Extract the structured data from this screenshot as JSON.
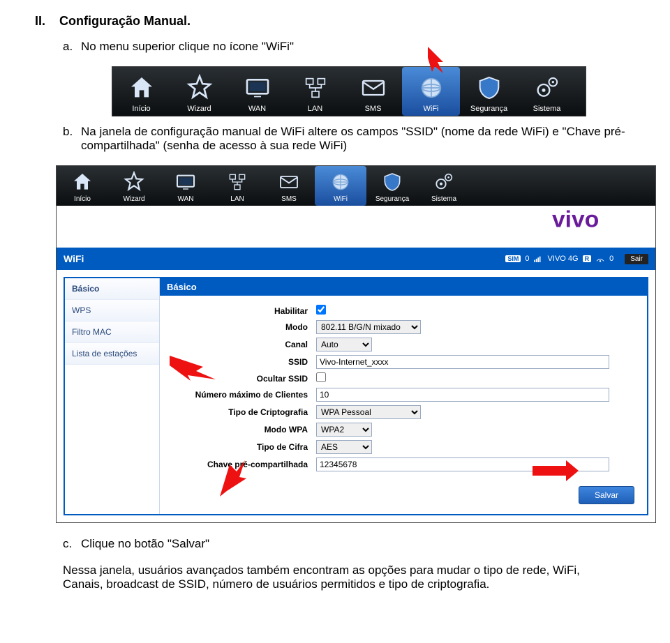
{
  "doc": {
    "section_num": "II.",
    "section_title": "Configuração Manual.",
    "items": {
      "a": {
        "letter": "a.",
        "text": "No menu superior clique no ícone \"WiFi\""
      },
      "b": {
        "letter": "b.",
        "text": "Na janela de configuração manual de WiFi altere os campos \"SSID\" (nome da rede WiFi) e \"Chave pré-compartilhada\" (senha de acesso à sua rede WiFi)"
      },
      "c": {
        "letter": "c.",
        "text": "Clique no botão \"Salvar\""
      }
    },
    "footer": "Nessa janela, usuários avançados também encontram as opções para mudar o tipo de rede, WiFi, Canais, broadcast de SSID, número de usuários permitidos e tipo de criptografia."
  },
  "menu": {
    "inicio": "Início",
    "wizard": "Wizard",
    "wan": "WAN",
    "lan": "LAN",
    "sms": "SMS",
    "wifi": "WiFi",
    "seguranca": "Segurança",
    "sistema": "Sistema"
  },
  "brand_text": "vivo",
  "wifi_header": {
    "title": "WiFi",
    "status_0a": "0",
    "status_net": "VIVO 4G",
    "status_r": "R",
    "status_0b": "0",
    "sair": "Sair"
  },
  "sidenav": {
    "basico": "Básico",
    "wps": "WPS",
    "filtro_mac": "Filtro MAC",
    "lista_estacoes": "Lista de estações"
  },
  "panel_title": "Básico",
  "form": {
    "habilitar": {
      "label": "Habilitar",
      "checked": true
    },
    "modo": {
      "label": "Modo",
      "value": "802.11 B/G/N mixado"
    },
    "canal": {
      "label": "Canal",
      "value": "Auto"
    },
    "ssid": {
      "label": "SSID",
      "value": "Vivo-Internet_xxxx"
    },
    "ocultar_ssid": {
      "label": "Ocultar SSID",
      "checked": false
    },
    "max_clientes": {
      "label": "Número máximo de Clientes",
      "value": "10"
    },
    "tipo_cripto": {
      "label": "Tipo de Criptografia",
      "value": "WPA Pessoal"
    },
    "modo_wpa": {
      "label": "Modo WPA",
      "value": "WPA2"
    },
    "tipo_cifra": {
      "label": "Tipo de Cifra",
      "value": "AES"
    },
    "chave": {
      "label": "Chave pré-compartilhada",
      "value": "12345678"
    },
    "save": "Salvar"
  }
}
